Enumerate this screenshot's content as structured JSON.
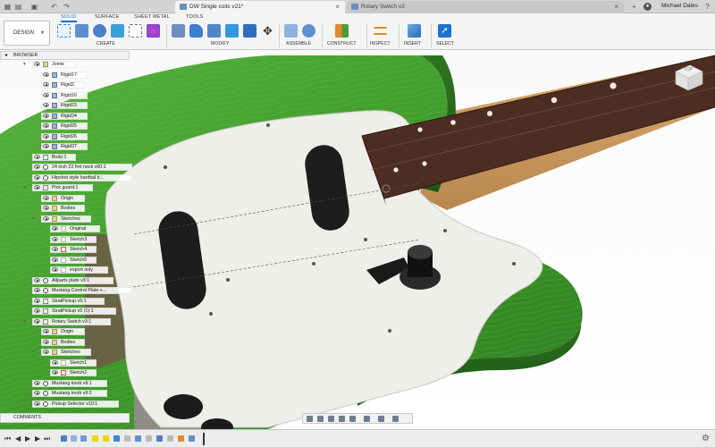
{
  "app": {
    "active_tab": "DW Single coils v21*",
    "inactive_tab": "Rotary Switch v3",
    "user_name": "Michael Dales"
  },
  "ribbon": {
    "workspace": "DESIGN",
    "tabs": [
      "SOLID",
      "SURFACE",
      "SHEET METAL",
      "TOOLS"
    ],
    "groups": [
      "CREATE",
      "MODIFY",
      "ASSEMBLE",
      "CONSTRUCT",
      "INSPECT",
      "INSERT",
      "SELECT"
    ]
  },
  "browser": {
    "title": "BROWSER",
    "items": [
      {
        "label": "Joints",
        "type": "folder"
      },
      {
        "label": "Rigid17",
        "type": "joint"
      },
      {
        "label": "Rigid2",
        "type": "joint"
      },
      {
        "label": "Rigid16",
        "type": "joint"
      },
      {
        "label": "Rigid23",
        "type": "joint"
      },
      {
        "label": "Rigid24",
        "type": "joint"
      },
      {
        "label": "Rigid25",
        "type": "joint"
      },
      {
        "label": "Rigid26",
        "type": "joint"
      },
      {
        "label": "Rigid27",
        "type": "joint"
      },
      {
        "label": "Body:1",
        "type": "component"
      },
      {
        "label": "24 inch 22 fret neck v60:1",
        "type": "link"
      },
      {
        "label": "Hipshot style hardtail b...",
        "type": "link"
      },
      {
        "label": "Pick guard:1",
        "type": "component"
      },
      {
        "label": "Origin",
        "type": "folder"
      },
      {
        "label": "Bodies",
        "type": "folder"
      },
      {
        "label": "Sketches",
        "type": "folder"
      },
      {
        "label": "Original",
        "type": "sketch"
      },
      {
        "label": "Sketch3",
        "type": "sketch"
      },
      {
        "label": "Sketch4",
        "type": "sketch-red"
      },
      {
        "label": "Sketch5",
        "type": "sketch"
      },
      {
        "label": "export only",
        "type": "sketch"
      },
      {
        "label": "Allparts plate v3:1",
        "type": "link"
      },
      {
        "label": "Mustang Control Plate v...",
        "type": "link"
      },
      {
        "label": "StratPickup v5:1",
        "type": "component"
      },
      {
        "label": "StratPickup v5 (1):1",
        "type": "component"
      },
      {
        "label": "Rotary Switch v3:1",
        "type": "component"
      },
      {
        "label": "Origin",
        "type": "folder"
      },
      {
        "label": "Bodies",
        "type": "folder"
      },
      {
        "label": "Sketches",
        "type": "folder"
      },
      {
        "label": "Sketch1",
        "type": "sketch"
      },
      {
        "label": "Sketch2",
        "type": "sketch-red"
      },
      {
        "label": "Mustang knob v9:1",
        "type": "link"
      },
      {
        "label": "Mustang knob v9:2",
        "type": "link"
      },
      {
        "label": "Pickup Selector v10:1",
        "type": "link"
      }
    ]
  },
  "comments": {
    "title": "COMMENTS"
  },
  "viewcube": {
    "label": "TOP"
  },
  "colors": {
    "accent": "#1a6fd0",
    "body_green": "#3f9a2b",
    "pickguard": "#eeeeea",
    "fretboard": "#4d2d22",
    "neck_wood": "#c89a62"
  }
}
